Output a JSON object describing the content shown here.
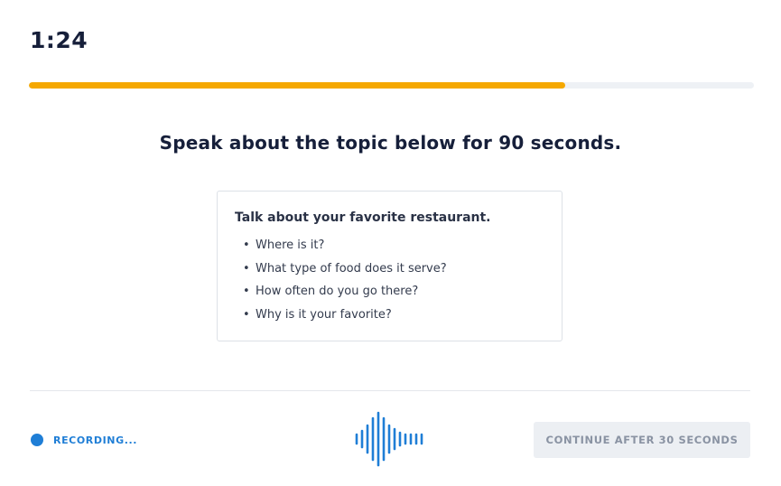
{
  "timer": {
    "display": "1:24"
  },
  "progress": {
    "fraction": 0.74,
    "fill_color": "#f5a800",
    "track_color": "#eef1f5"
  },
  "prompt": {
    "heading": "Speak about the topic below for 90 seconds."
  },
  "topic": {
    "title": "Talk about your favorite restaurant.",
    "bullet": "•",
    "questions": [
      "Where is it?",
      "What type of food does it serve?",
      "How often do you go there?",
      "Why is it your favorite?"
    ]
  },
  "recording": {
    "label": "RECORDING...",
    "status_color": "#1f7ed6",
    "icon": "audio-waveform-icon"
  },
  "footer": {
    "continue_label": "CONTINUE AFTER 30 SECONDS",
    "continue_enabled": false
  }
}
